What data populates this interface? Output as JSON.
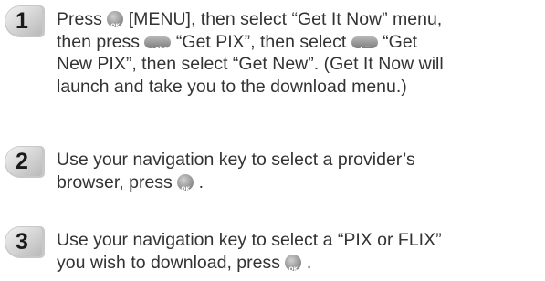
{
  "steps": [
    {
      "number": "1",
      "lines": [
        {
          "before": "Press",
          "icon": "ok-key-icon",
          "after": "[MENU], then select “Get It Now” menu,"
        },
        {
          "before": "then press",
          "icon": "two-key-icon",
          "after": "“Get PIX”, then select",
          "icon2": "one-key-icon",
          "after2": "“Get"
        },
        {
          "text": "New PIX”, then select “Get New”. (Get It Now will"
        },
        {
          "text": "launch and take you to the download menu.)"
        }
      ]
    },
    {
      "number": "2",
      "lines": [
        {
          "text": "Use your navigation key to select a provider’s"
        },
        {
          "before": "browser, press",
          "icon": "ok-key-icon",
          "after": "."
        }
      ]
    },
    {
      "number": "3",
      "lines": [
        {
          "text": "Use your navigation key to select a “PIX or FLIX”"
        },
        {
          "before": "you wish to download, press",
          "icon": "ok-key-icon",
          "after": "."
        }
      ]
    }
  ]
}
